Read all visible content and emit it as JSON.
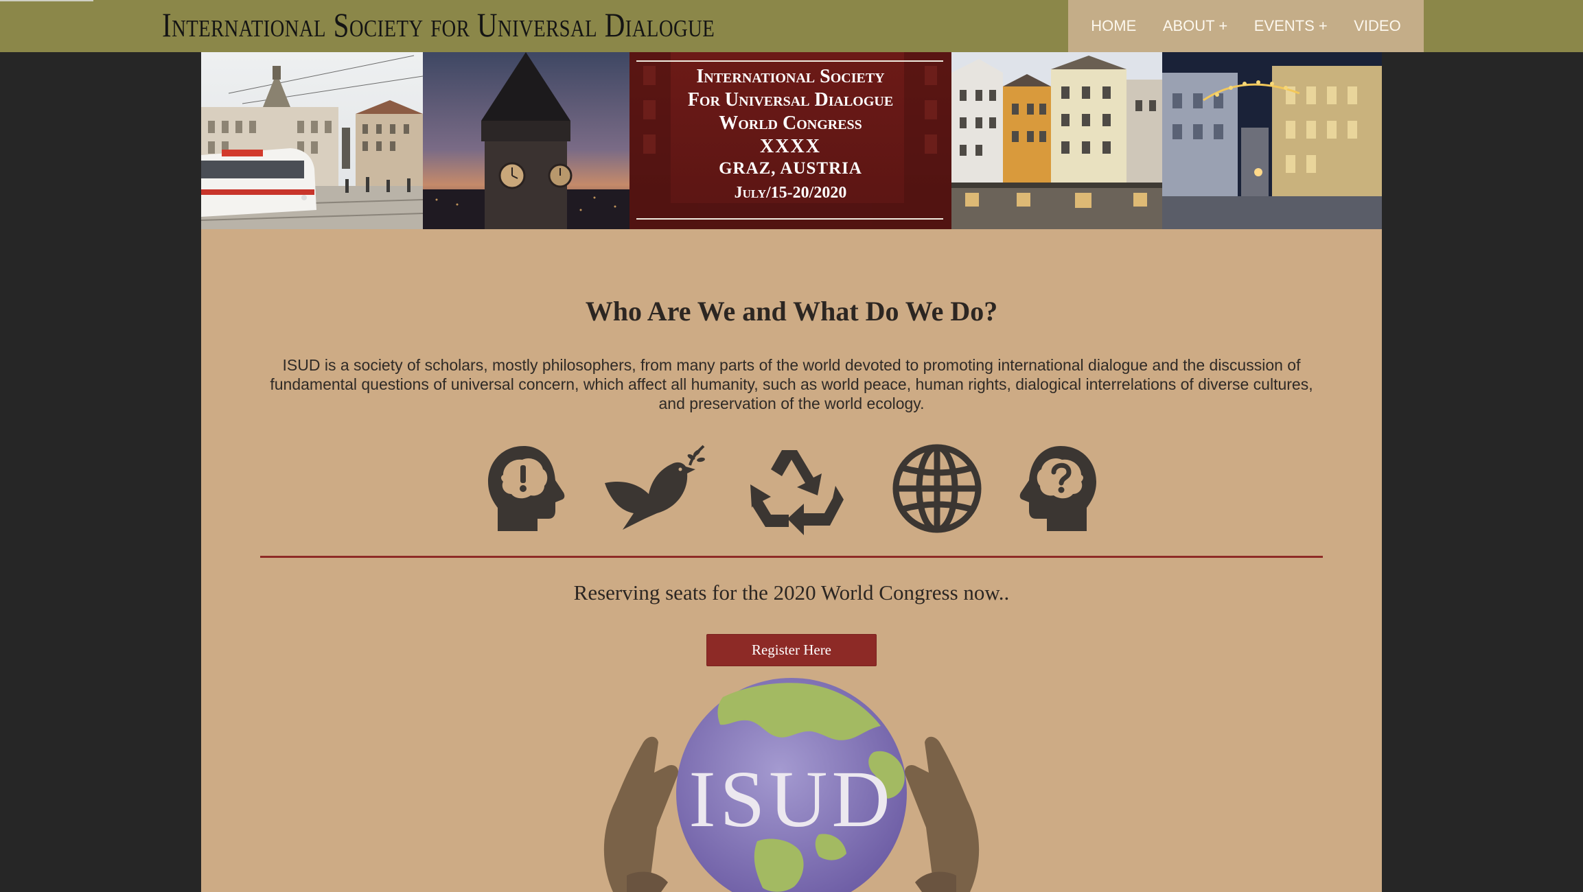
{
  "header": {
    "site_title": "International Society for Universal Dialogue"
  },
  "nav": {
    "items": [
      {
        "label": "HOME"
      },
      {
        "label": "ABOUT +"
      },
      {
        "label": "EVENTS +"
      },
      {
        "label": "VIDEO"
      }
    ]
  },
  "banner": {
    "lines": [
      "International Society",
      "For Universal Dialogue",
      "World Congress",
      "XXXX",
      "GRAZ, AUSTRIA",
      "July/15-20/2020"
    ]
  },
  "main": {
    "heading": "Who Are We and What Do We Do?",
    "intro": "ISUD is a society of scholars, mostly philosophers, from many parts of the world devoted to promoting international dialogue and the discussion of fundamental questions of universal concern, which affect all humanity, such as world peace, human rights, dialogical interrelations of diverse cultures, and preservation of the world ecology.",
    "icons": [
      "head-exclamation-icon",
      "peace-dove-icon",
      "recycle-icon",
      "globe-icon",
      "head-question-icon"
    ],
    "icon_marks": {
      "exclamation": "!",
      "question": "?"
    },
    "reserve_text": "Reserving seats for the 2020 World Congress now..",
    "register_label": "Register Here",
    "logo_text": "ISUD"
  },
  "colors": {
    "topbar": "#8b8749",
    "nav_bg": "#c4ad88",
    "panel": "#cdab85",
    "background": "#262626",
    "accent": "#8d2a26",
    "icon": "#3b3632"
  }
}
